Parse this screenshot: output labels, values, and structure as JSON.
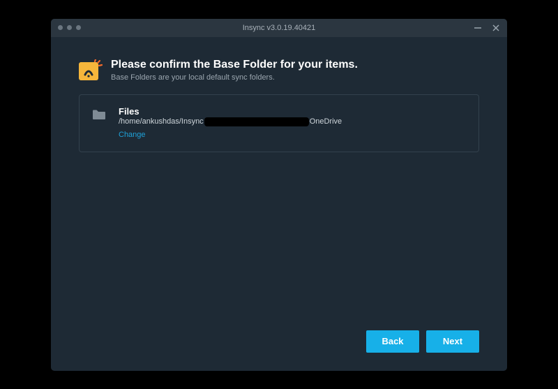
{
  "window": {
    "title": "Insync v3.0.19.40421"
  },
  "header": {
    "heading": "Please confirm the Base Folder for your items.",
    "subheading": "Base Folders are your local default sync folders."
  },
  "folder_card": {
    "title": "Files",
    "path_prefix": "/home/ankushdas/Insync",
    "path_suffix": "OneDrive",
    "change_label": "Change"
  },
  "footer": {
    "back_label": "Back",
    "next_label": "Next"
  },
  "colors": {
    "accent": "#17b0e8",
    "icon_yellow": "#f6b63b",
    "icon_orange": "#f46a2a",
    "bg": "#1e2a35"
  }
}
